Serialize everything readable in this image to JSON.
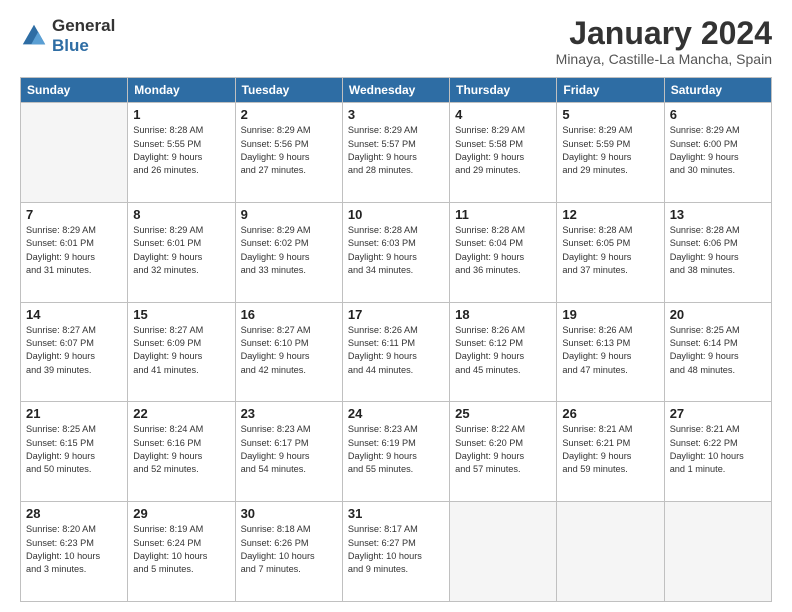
{
  "header": {
    "logo": {
      "general": "General",
      "blue": "Blue"
    },
    "title": "January 2024",
    "location": "Minaya, Castille-La Mancha, Spain"
  },
  "calendar": {
    "weekdays": [
      "Sunday",
      "Monday",
      "Tuesday",
      "Wednesday",
      "Thursday",
      "Friday",
      "Saturday"
    ],
    "weeks": [
      [
        {
          "day": "",
          "info": ""
        },
        {
          "day": "1",
          "info": "Sunrise: 8:28 AM\nSunset: 5:55 PM\nDaylight: 9 hours\nand 26 minutes."
        },
        {
          "day": "2",
          "info": "Sunrise: 8:29 AM\nSunset: 5:56 PM\nDaylight: 9 hours\nand 27 minutes."
        },
        {
          "day": "3",
          "info": "Sunrise: 8:29 AM\nSunset: 5:57 PM\nDaylight: 9 hours\nand 28 minutes."
        },
        {
          "day": "4",
          "info": "Sunrise: 8:29 AM\nSunset: 5:58 PM\nDaylight: 9 hours\nand 29 minutes."
        },
        {
          "day": "5",
          "info": "Sunrise: 8:29 AM\nSunset: 5:59 PM\nDaylight: 9 hours\nand 29 minutes."
        },
        {
          "day": "6",
          "info": "Sunrise: 8:29 AM\nSunset: 6:00 PM\nDaylight: 9 hours\nand 30 minutes."
        }
      ],
      [
        {
          "day": "7",
          "info": "Sunrise: 8:29 AM\nSunset: 6:01 PM\nDaylight: 9 hours\nand 31 minutes."
        },
        {
          "day": "8",
          "info": "Sunrise: 8:29 AM\nSunset: 6:01 PM\nDaylight: 9 hours\nand 32 minutes."
        },
        {
          "day": "9",
          "info": "Sunrise: 8:29 AM\nSunset: 6:02 PM\nDaylight: 9 hours\nand 33 minutes."
        },
        {
          "day": "10",
          "info": "Sunrise: 8:28 AM\nSunset: 6:03 PM\nDaylight: 9 hours\nand 34 minutes."
        },
        {
          "day": "11",
          "info": "Sunrise: 8:28 AM\nSunset: 6:04 PM\nDaylight: 9 hours\nand 36 minutes."
        },
        {
          "day": "12",
          "info": "Sunrise: 8:28 AM\nSunset: 6:05 PM\nDaylight: 9 hours\nand 37 minutes."
        },
        {
          "day": "13",
          "info": "Sunrise: 8:28 AM\nSunset: 6:06 PM\nDaylight: 9 hours\nand 38 minutes."
        }
      ],
      [
        {
          "day": "14",
          "info": "Sunrise: 8:27 AM\nSunset: 6:07 PM\nDaylight: 9 hours\nand 39 minutes."
        },
        {
          "day": "15",
          "info": "Sunrise: 8:27 AM\nSunset: 6:09 PM\nDaylight: 9 hours\nand 41 minutes."
        },
        {
          "day": "16",
          "info": "Sunrise: 8:27 AM\nSunset: 6:10 PM\nDaylight: 9 hours\nand 42 minutes."
        },
        {
          "day": "17",
          "info": "Sunrise: 8:26 AM\nSunset: 6:11 PM\nDaylight: 9 hours\nand 44 minutes."
        },
        {
          "day": "18",
          "info": "Sunrise: 8:26 AM\nSunset: 6:12 PM\nDaylight: 9 hours\nand 45 minutes."
        },
        {
          "day": "19",
          "info": "Sunrise: 8:26 AM\nSunset: 6:13 PM\nDaylight: 9 hours\nand 47 minutes."
        },
        {
          "day": "20",
          "info": "Sunrise: 8:25 AM\nSunset: 6:14 PM\nDaylight: 9 hours\nand 48 minutes."
        }
      ],
      [
        {
          "day": "21",
          "info": "Sunrise: 8:25 AM\nSunset: 6:15 PM\nDaylight: 9 hours\nand 50 minutes."
        },
        {
          "day": "22",
          "info": "Sunrise: 8:24 AM\nSunset: 6:16 PM\nDaylight: 9 hours\nand 52 minutes."
        },
        {
          "day": "23",
          "info": "Sunrise: 8:23 AM\nSunset: 6:17 PM\nDaylight: 9 hours\nand 54 minutes."
        },
        {
          "day": "24",
          "info": "Sunrise: 8:23 AM\nSunset: 6:19 PM\nDaylight: 9 hours\nand 55 minutes."
        },
        {
          "day": "25",
          "info": "Sunrise: 8:22 AM\nSunset: 6:20 PM\nDaylight: 9 hours\nand 57 minutes."
        },
        {
          "day": "26",
          "info": "Sunrise: 8:21 AM\nSunset: 6:21 PM\nDaylight: 9 hours\nand 59 minutes."
        },
        {
          "day": "27",
          "info": "Sunrise: 8:21 AM\nSunset: 6:22 PM\nDaylight: 10 hours\nand 1 minute."
        }
      ],
      [
        {
          "day": "28",
          "info": "Sunrise: 8:20 AM\nSunset: 6:23 PM\nDaylight: 10 hours\nand 3 minutes."
        },
        {
          "day": "29",
          "info": "Sunrise: 8:19 AM\nSunset: 6:24 PM\nDaylight: 10 hours\nand 5 minutes."
        },
        {
          "day": "30",
          "info": "Sunrise: 8:18 AM\nSunset: 6:26 PM\nDaylight: 10 hours\nand 7 minutes."
        },
        {
          "day": "31",
          "info": "Sunrise: 8:17 AM\nSunset: 6:27 PM\nDaylight: 10 hours\nand 9 minutes."
        },
        {
          "day": "",
          "info": ""
        },
        {
          "day": "",
          "info": ""
        },
        {
          "day": "",
          "info": ""
        }
      ]
    ]
  }
}
